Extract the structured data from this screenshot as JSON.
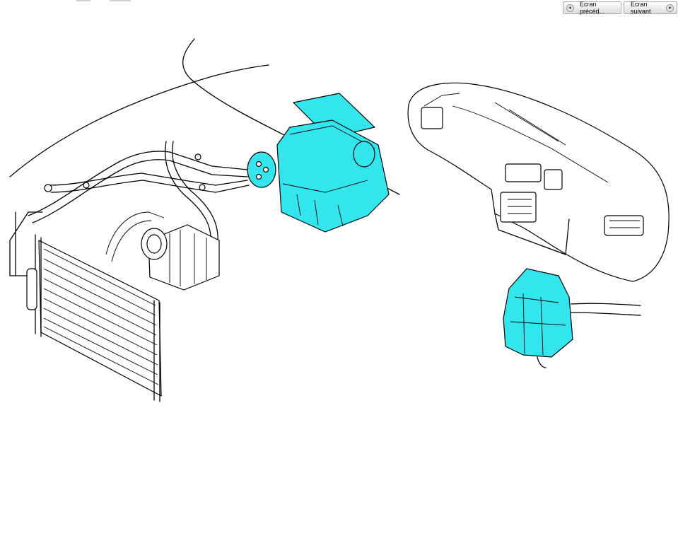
{
  "toolbar": {
    "prev_label": "Ecran précéd...",
    "next_label": "Ecran suivant",
    "prev_icon": "arrow-left-icon",
    "next_icon": "arrow-right-icon"
  },
  "diagram": {
    "highlight_color": "#33e6ee",
    "line_color": "#000000",
    "background": "#ffffff"
  }
}
